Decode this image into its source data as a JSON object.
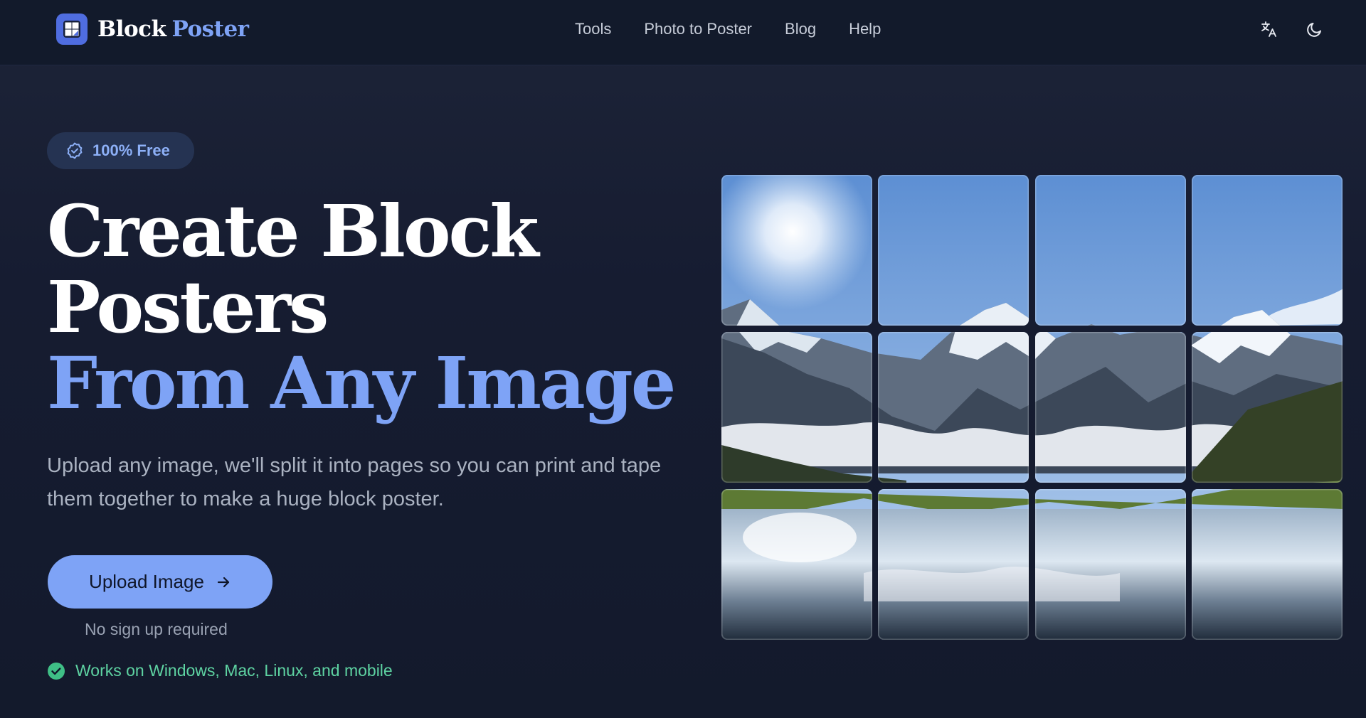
{
  "header": {
    "logo_word1": "Block",
    "logo_word2": "Poster",
    "nav": [
      "Tools",
      "Photo to Poster",
      "Blog",
      "Help"
    ],
    "icons": [
      "translate-icon",
      "moon-icon"
    ]
  },
  "hero": {
    "badge": "100% Free",
    "headline_line1": "Create Block",
    "headline_line2": "Posters",
    "headline_accent": "From Any Image",
    "subtext": "Upload any image, we'll split it into pages so you can print and tape them together to make a huge block poster.",
    "upload_button": "Upload Image",
    "no_signup": "No sign up required",
    "works_on": "Works on Windows, Mac, Linux, and mobile"
  },
  "poster_grid": {
    "rows": 3,
    "cols": 4,
    "image_subject": "mountain lake landscape"
  },
  "colors": {
    "background": "#141a2e",
    "header": "#121a2b",
    "accent": "#7ea3f6",
    "success": "#5ed3a2"
  }
}
